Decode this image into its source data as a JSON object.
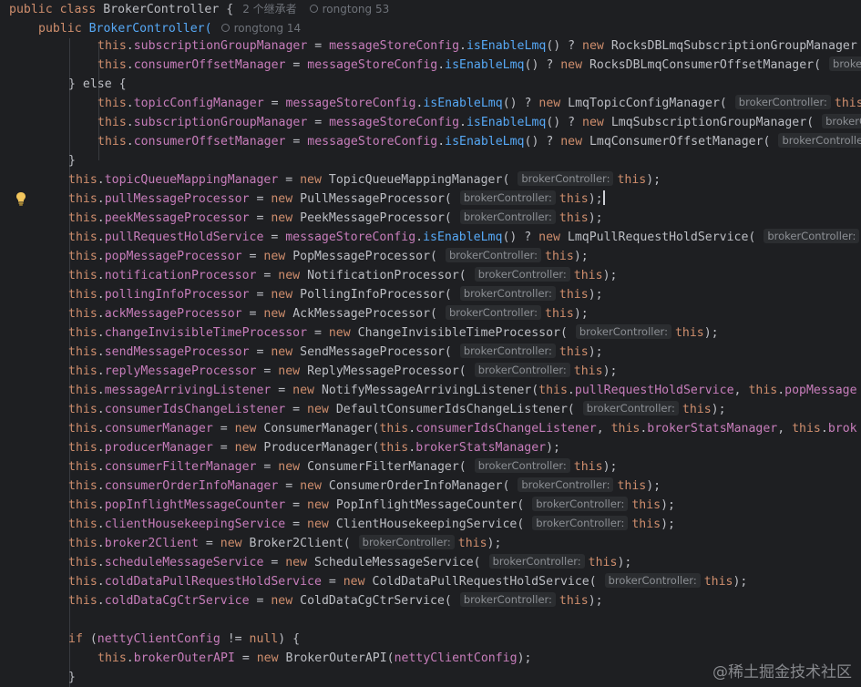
{
  "header": {
    "line1_kw": "public class",
    "line1_class": "BrokerController",
    "line1_brace": "{",
    "inheritors": "2 个继承者",
    "author1": "rongtong 53",
    "line2_kw": "public",
    "line2_ctor": "BrokerController(",
    "author2": "rongtong 14"
  },
  "hint": "brokerController:",
  "lines": {
    "l3_field": "subscriptionGroupManager",
    "l3_cfg": "messageStoreConfig",
    "l3_mth": "isEnableLmq",
    "l3_cls": "RocksDBLmqSubscriptionGroupManager",
    "l4_field": "consumerOffsetManager",
    "l4_cls": "RocksDBLmqConsumerOffsetManager",
    "l4_hint": "broke",
    "l5_else": "} else {",
    "l6_field": "topicConfigManager",
    "l6_cls": "LmqTopicConfigManager",
    "l7_cls": "LmqSubscriptionGroupManager",
    "l7_hint": "brokerC",
    "l8_cls": "LmqConsumerOffsetManager",
    "l8_hint": "brokerControlle",
    "l9_close": "}",
    "l10_field": "topicQueueMappingManager",
    "l10_cls": "TopicQueueMappingManager",
    "l11_field": "pullMessageProcessor",
    "l11_cls": "PullMessageProcessor",
    "l12_field": "peekMessageProcessor",
    "l12_cls": "PeekMessageProcessor",
    "l13_field": "pullRequestHoldService",
    "l13_cls": "LmqPullRequestHoldService",
    "l13_tail": "t",
    "l14_field": "popMessageProcessor",
    "l14_cls": "PopMessageProcessor",
    "l15_field": "notificationProcessor",
    "l15_cls": "NotificationProcessor",
    "l16_field": "pollingInfoProcessor",
    "l16_cls": "PollingInfoProcessor",
    "l17_field": "ackMessageProcessor",
    "l17_cls": "AckMessageProcessor",
    "l18_field": "changeInvisibleTimeProcessor",
    "l18_cls": "ChangeInvisibleTimeProcessor",
    "l19_field": "sendMessageProcessor",
    "l19_cls": "SendMessageProcessor",
    "l20_field": "replyMessageProcessor",
    "l20_cls": "ReplyMessageProcessor",
    "l21_field": "messageArrivingListener",
    "l21_cls": "NotifyMessageArrivingListener",
    "l21_arg1": "pullRequestHoldService",
    "l21_arg2": "popMessage",
    "l22_field": "consumerIdsChangeListener",
    "l22_cls": "DefaultConsumerIdsChangeListener",
    "l23_field": "consumerManager",
    "l23_cls": "ConsumerManager",
    "l23_arg1": "consumerIdsChangeListener",
    "l23_arg2": "brokerStatsManager",
    "l23_arg3": "brok",
    "l24_field": "producerManager",
    "l24_cls": "ProducerManager",
    "l24_arg": "brokerStatsManager",
    "l25_field": "consumerFilterManager",
    "l25_cls": "ConsumerFilterManager",
    "l26_field": "consumerOrderInfoManager",
    "l26_cls": "ConsumerOrderInfoManager",
    "l27_field": "popInflightMessageCounter",
    "l27_cls": "PopInflightMessageCounter",
    "l28_field": "clientHousekeepingService",
    "l28_cls": "ClientHousekeepingService",
    "l29_field": "broker2Client",
    "l29_cls": "Broker2Client",
    "l30_field": "scheduleMessageService",
    "l30_cls": "ScheduleMessageService",
    "l31_field": "coldDataPullRequestHoldService",
    "l31_cls": "ColdDataPullRequestHoldService",
    "l32_field": "coldDataCgCtrService",
    "l32_cls": "ColdDataCgCtrService",
    "l34_if": "if",
    "l34_var": "nettyClientConfig",
    "l34_null": "null",
    "l35_field": "brokerOuterAPI",
    "l35_cls": "BrokerOuterAPI",
    "l35_arg": "nettyClientConfig",
    "l36_close": "}"
  },
  "tokens": {
    "this": "this",
    "new": "new"
  },
  "watermark": "@稀土掘金技术社区",
  "icons": {
    "gutter": "lightbulb-icon",
    "author": "person-icon"
  },
  "colors": {
    "background": "#1e1f22",
    "keyword": "#cf8e6d",
    "field": "#c77dbb",
    "method": "#56a8f5",
    "text": "#bcbec4",
    "hint_bg": "#2b2d30"
  }
}
